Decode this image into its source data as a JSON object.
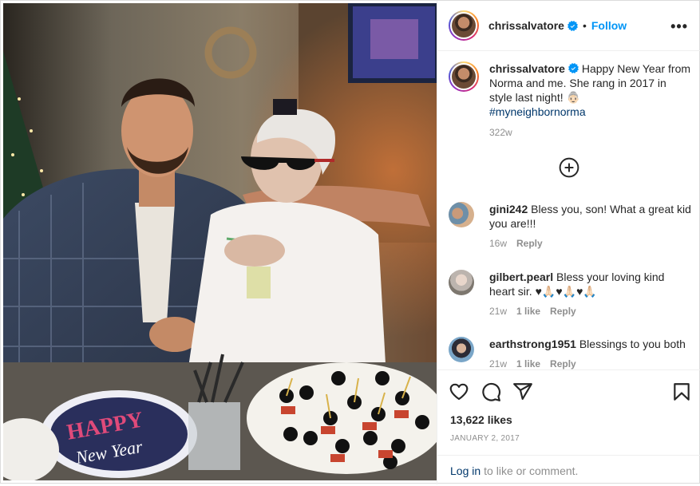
{
  "post": {
    "username": "chrissalvatore",
    "follow_label": "Follow",
    "separator": "•",
    "more_label": "•••"
  },
  "caption": {
    "username": "chrissalvatore",
    "text": "Happy New Year from Norma and me. She rang in 2017 in style last night!",
    "emoji": "👵🏻",
    "hashtag": "#myneighbornorma",
    "time": "322w"
  },
  "comments": [
    {
      "username": "gini242",
      "text": "Bless you, son! What a great kid you are!!!",
      "time": "16w",
      "likes": "",
      "reply": "Reply"
    },
    {
      "username": "gilbert.pearl",
      "text": "Bless your loving kind heart sir. ♥🙏🏻♥🙏🏻♥🙏🏻",
      "time": "21w",
      "likes": "1 like",
      "reply": "Reply"
    },
    {
      "username": "earthstrong1951",
      "text": "Blessings to you both",
      "time": "21w",
      "likes": "1 like",
      "reply": "Reply"
    }
  ],
  "stats": {
    "likes": "13,622 likes",
    "date": "JANUARY 2, 2017"
  },
  "login": {
    "link": "Log in",
    "rest": "to like or comment."
  },
  "photo": {
    "plate_text_1": "HAPPY",
    "plate_text_2": "New Year"
  },
  "colors": {
    "accent": "#0095f6",
    "hashtag": "#00376b",
    "muted": "#8e8e8e"
  }
}
